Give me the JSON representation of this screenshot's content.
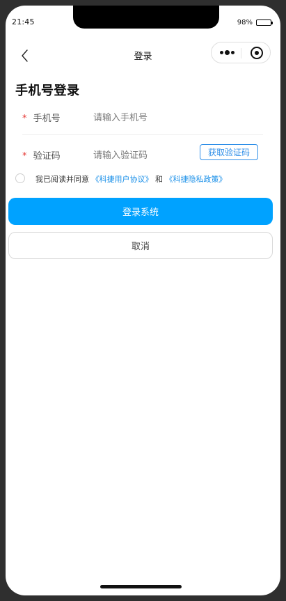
{
  "status_bar": {
    "time": "21:45",
    "battery_percent_text": "98%",
    "battery_level": 0.98,
    "battery_icon": "battery-icon"
  },
  "nav": {
    "title": "登录",
    "back_icon": "chevron-left-icon",
    "more_icon": "more-dots-icon",
    "close_icon": "target-icon"
  },
  "page": {
    "title": "手机号登录"
  },
  "form": {
    "phone": {
      "required_mark": "*",
      "label": "手机号",
      "value": "",
      "placeholder": "请输入手机号"
    },
    "code": {
      "required_mark": "*",
      "label": "验证码",
      "value": "",
      "placeholder": "请输入验证码",
      "button_label": "获取验证码"
    }
  },
  "agreement": {
    "prefix": "我已阅读并同意",
    "user_agreement": "《科捷用户协议》",
    "connector": "和",
    "privacy_policy": "《科捷隐私政策》",
    "checked": false
  },
  "actions": {
    "login_label": "登录系统",
    "cancel_label": "取消"
  },
  "colors": {
    "primary": "#00a2ff",
    "link": "#168ee8",
    "required": "#e53935",
    "outline": "#2e8ee8"
  }
}
